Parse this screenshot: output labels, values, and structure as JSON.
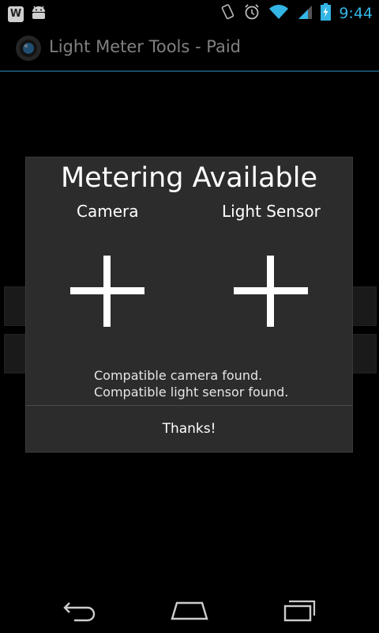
{
  "status_bar": {
    "time": "9:44",
    "notif_letter": "W",
    "icons": [
      "wordpress-icon",
      "android-icon",
      "vibrate-icon",
      "alarm-icon",
      "wifi-icon",
      "signal-icon",
      "battery-icon"
    ]
  },
  "action_bar": {
    "title": "Light Meter Tools - Paid",
    "icon": "camera-lens-icon"
  },
  "dialog": {
    "title": "Metering Available",
    "columns": {
      "camera": "Camera",
      "sensor": "Light Sensor"
    },
    "messages": [
      "Compatible camera found.",
      "Compatible light sensor found."
    ],
    "button_label": "Thanks!"
  },
  "nav_bar": {
    "icons": [
      "back-icon",
      "home-icon",
      "recents-icon"
    ]
  },
  "colors": {
    "accent": "#33b5e5",
    "dialog_bg": "#2c2c2c",
    "background": "#000000"
  }
}
